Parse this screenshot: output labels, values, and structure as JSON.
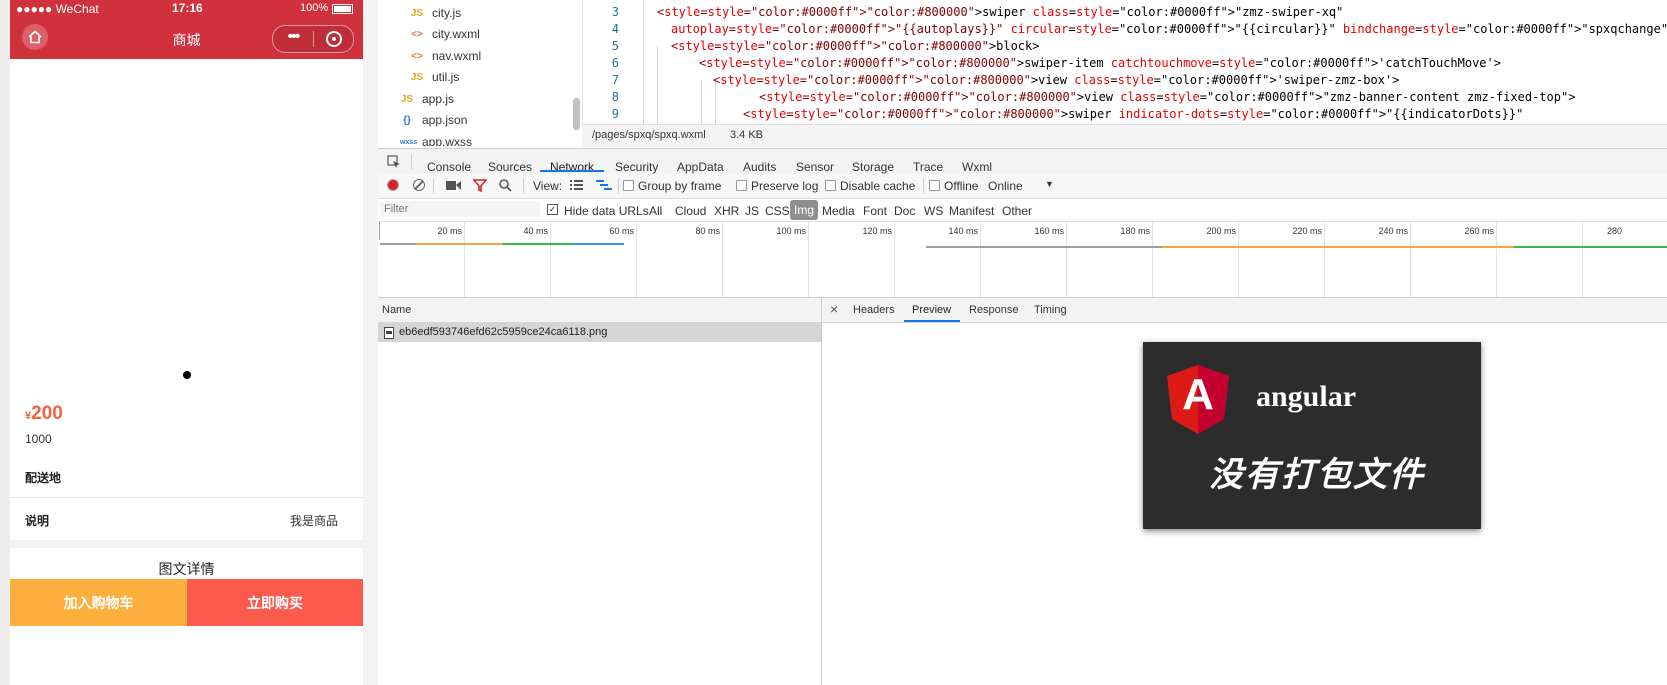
{
  "phone": {
    "status": {
      "carrier": "●●●●● WeChat",
      "time": "17:16",
      "battery": "100%"
    },
    "nav_title": "商城",
    "price": "200",
    "currency": "¥",
    "stock": "1000",
    "delivery_label": "配送地",
    "desc_label": "说明",
    "desc_value": "我是商品",
    "detail_title": "图文详情",
    "add_cart": "加入购物车",
    "buy_now": "立即购买"
  },
  "file_tree": [
    {
      "icon": "JS",
      "name": "city.js"
    },
    {
      "icon": "<>",
      "name": "city.wxml"
    },
    {
      "icon": "<>",
      "name": "nav.wxml"
    },
    {
      "icon": "JS",
      "name": "util.js"
    },
    {
      "icon": "JS",
      "name": "app.js"
    },
    {
      "icon": "{}",
      "name": "app.json"
    },
    {
      "icon": "wxss",
      "name": "app.wxss"
    }
  ],
  "editor": {
    "lines": [
      {
        "n": "3",
        "code": "<swiper class=\"zmz-swiper-xq\""
      },
      {
        "n": "4",
        "code": "  autoplay=\"{{autoplays}}\" circular=\"{{circular}}\" bindchange=\"spxqchange\" current=\"{{current}}\" duration=\"{{duration}}\" >"
      },
      {
        "n": "5",
        "code": "  <block>"
      },
      {
        "n": "6",
        "code": "      <swiper-item catchtouchmove='catchTouchMove'>"
      },
      {
        "n": "7",
        "code": "        <view class='swiper-zmz-box'>"
      },
      {
        "n": "8",
        "code": "              <view class=\"zmz-banner-content zmz-fixed-top\">"
      },
      {
        "n": "9",
        "code": "            <swiper indicator-dots=\"{{indicatorDots}}\""
      }
    ],
    "path": "/pages/spxq/spxq.wxml",
    "size": "3.4 KB"
  },
  "devtools": {
    "tabs": [
      "Console",
      "Sources",
      "Network",
      "Security",
      "AppData",
      "Audits",
      "Sensor",
      "Storage",
      "Trace",
      "Wxml"
    ],
    "active_tab": "Network",
    "toolbar": {
      "view": "View:",
      "group_by_frame": "Group by frame",
      "preserve_log": "Preserve log",
      "disable_cache": "Disable cache",
      "offline": "Offline",
      "online": "Online"
    },
    "filter_placeholder": "Filter",
    "hide_data_urls": "Hide data URLs",
    "filter_types": [
      "All",
      "Cloud",
      "XHR",
      "JS",
      "CSS",
      "Img",
      "Media",
      "Font",
      "Doc",
      "WS",
      "Manifest",
      "Other"
    ],
    "active_filter": "Img",
    "ticks": [
      "20 ms",
      "40 ms",
      "60 ms",
      "80 ms",
      "100 ms",
      "120 ms",
      "140 ms",
      "160 ms",
      "180 ms",
      "200 ms",
      "220 ms",
      "240 ms",
      "260 ms",
      "280"
    ],
    "name_header": "Name",
    "requests": [
      "eb6edf593746efd62c5959ce24ca6118.png"
    ],
    "detail_tabs": [
      "Headers",
      "Preview",
      "Response",
      "Timing"
    ],
    "active_detail_tab": "Preview",
    "preview": {
      "logo_letter": "A",
      "title": "angular",
      "subtitle": "没有打包文件"
    }
  },
  "colors": {
    "brand_red": "#d0323d",
    "price_orange": "#f4613e",
    "add_cart_bg": "#fdaf3d",
    "buy_now_bg": "#fd5a4e",
    "devtools_blue": "#1a73e8"
  }
}
